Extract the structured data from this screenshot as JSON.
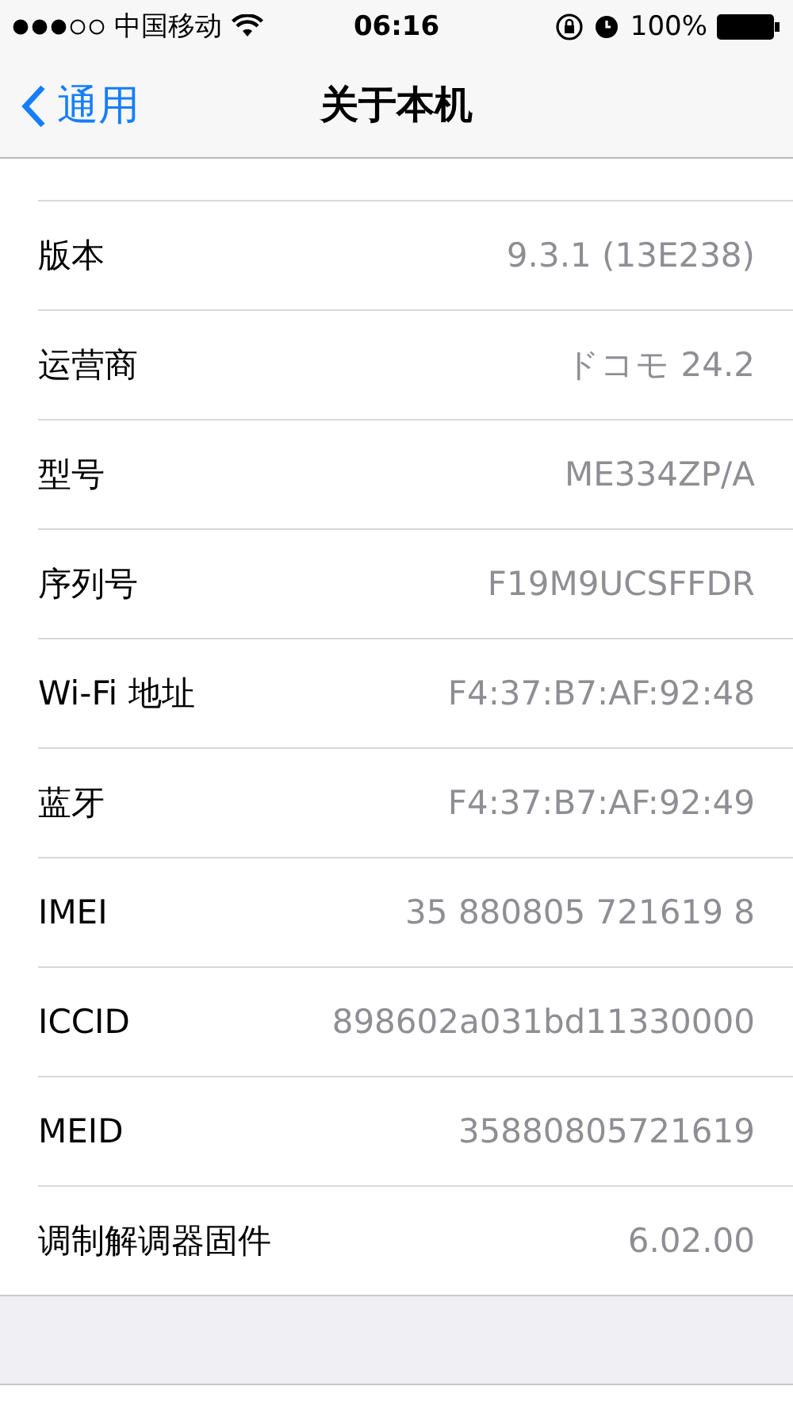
{
  "status_bar": {
    "carrier": "中国移动",
    "time": "06:16",
    "battery": "100%"
  },
  "nav": {
    "back": "通用",
    "title": "关于本机"
  },
  "rows": [
    {
      "label": "版本",
      "value": "9.3.1 (13E238)"
    },
    {
      "label": "运营商",
      "value": "ドコモ 24.2"
    },
    {
      "label": "型号",
      "value": "ME334ZP/A"
    },
    {
      "label": "序列号",
      "value": "F19M9UCSFFDR"
    },
    {
      "label": "Wi-Fi 地址",
      "value": "F4:37:B7:AF:92:48"
    },
    {
      "label": "蓝牙",
      "value": "F4:37:B7:AF:92:49"
    },
    {
      "label": "IMEI",
      "value": "35 880805 721619 8"
    },
    {
      "label": "ICCID",
      "value": "898602a031bd11330000"
    },
    {
      "label": "MEID",
      "value": "35880805721619"
    },
    {
      "label": "调制解调器固件",
      "value": "6.02.00"
    }
  ]
}
